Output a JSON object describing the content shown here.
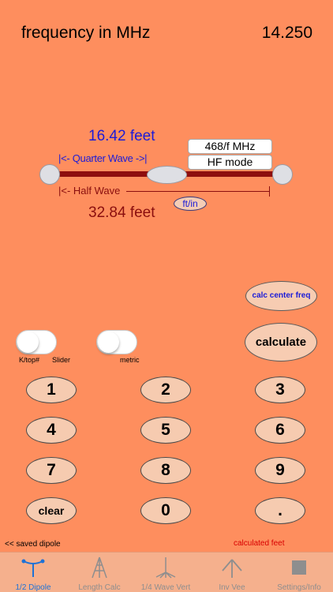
{
  "header": {
    "label": "frequency in MHz",
    "value": "14.250"
  },
  "antenna": {
    "quarter_length": "16.42 feet",
    "quarter_caption": "|<- Quarter Wave ->|",
    "half_caption": "|<- Half Wave",
    "half_length": "32.84 feet",
    "formula_button": "468/f MHz",
    "mode_button": "HF mode",
    "unit_toggle": "ft/in"
  },
  "controls": {
    "center_freq_button": "calc center freq",
    "calculate_button": "calculate",
    "toggle1_caption_a": "K/top#",
    "toggle1_caption_b": "Slider",
    "toggle2_caption": "metric"
  },
  "keypad": {
    "k1": "1",
    "k2": "2",
    "k3": "3",
    "k4": "4",
    "k5": "5",
    "k6": "6",
    "k7": "7",
    "k8": "8",
    "k9": "9",
    "clear": "clear",
    "k0": "0",
    "dot": "."
  },
  "footer": {
    "saved": "<< saved dipole",
    "calculated": "calculated feet"
  },
  "tabs": [
    {
      "label": "1/2 Dipole",
      "icon": "dipole-icon"
    },
    {
      "label": "Length Calc",
      "icon": "tower-icon"
    },
    {
      "label": "1/4 Wave Vert",
      "icon": "vertical-antenna-icon"
    },
    {
      "label": "Inv Vee",
      "icon": "inverted-vee-icon"
    },
    {
      "label": "Settings/Info",
      "icon": "settings-square-icon"
    }
  ],
  "colors": {
    "background": "#FE8E5E",
    "quarter_text": "#1B1BD8",
    "half_text": "#8A0E0E",
    "wire": "#8E0E0E",
    "active_tab": "#1E72D6",
    "calculated_text": "#D80000"
  }
}
